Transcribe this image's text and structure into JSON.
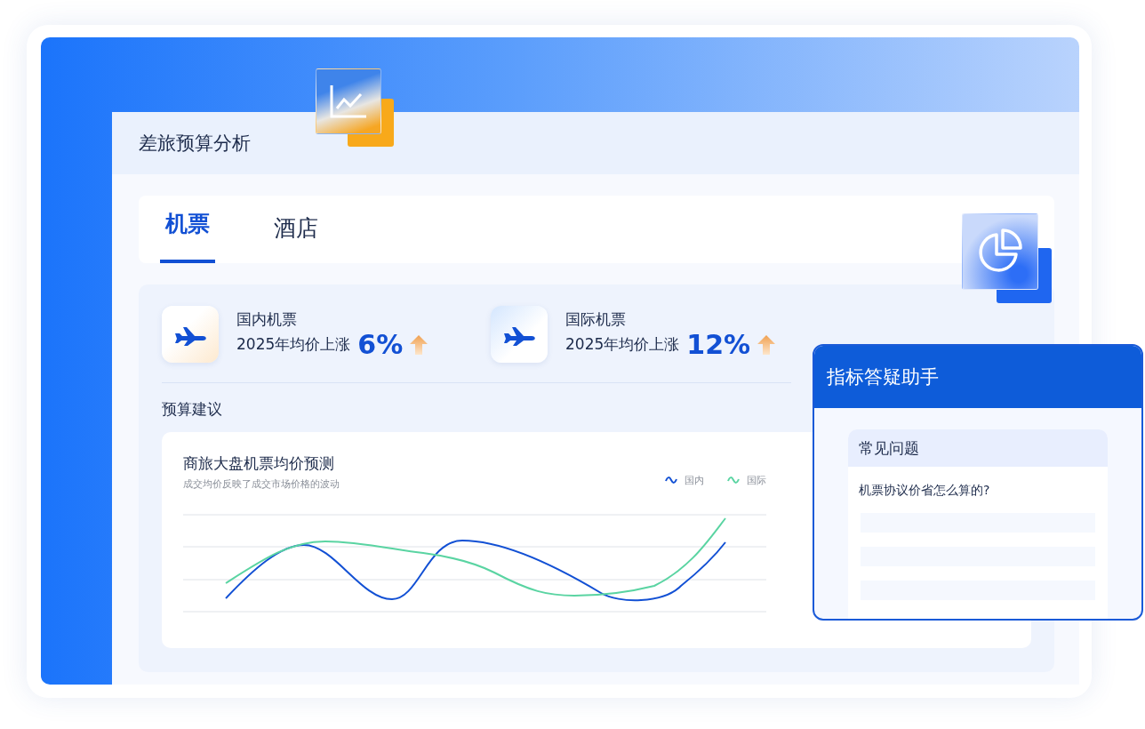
{
  "page": {
    "title": "差旅预算分析"
  },
  "tabs": [
    {
      "label": "机票",
      "selected": true
    },
    {
      "label": "酒店",
      "selected": false
    }
  ],
  "stats": [
    {
      "title": "国内机票",
      "subtitle": "2025年均价上涨",
      "value": "6%"
    },
    {
      "title": "国际机票",
      "subtitle": "2025年均价上涨",
      "value": "12%"
    }
  ],
  "section_label": "预算建议",
  "chart": {
    "title": "商旅大盘机票均价预测",
    "subtitle": "成交均价反映了成交市场价格的波动",
    "legend": [
      {
        "label": "国内",
        "color": "#1250d4"
      },
      {
        "label": "国际",
        "color": "#5ad4a2"
      }
    ]
  },
  "assistant": {
    "title": "指标答疑助手",
    "faq_title": "常见问题",
    "question": "机票协议价省怎么算的?"
  }
}
